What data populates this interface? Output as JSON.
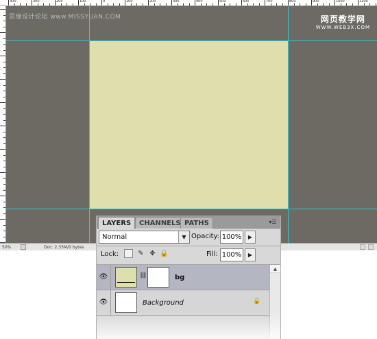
{
  "watermark": {
    "left": "思缘设计论坛 www.MISSYUAN.COM",
    "right_line1": "网页教学网",
    "right_line2": "WWW.WEB3X.COM"
  },
  "ruler": {
    "labels": [
      "400",
      "300",
      "200",
      "100",
      "0",
      "100",
      "200",
      "300",
      "400",
      "500",
      "600",
      "700",
      "800",
      "900",
      "1000",
      "1100",
      "1200",
      "1300"
    ]
  },
  "status_bar": {
    "zoom": "50%",
    "doc_info": "Doc: 2.33M/0 bytes"
  },
  "colors": {
    "canvas_background": "#6c6a63",
    "document_fill": "#dfdfae",
    "guide": "#31c6d4",
    "selected_layer": "#b4b6c2"
  },
  "layers_panel": {
    "tabs": [
      {
        "label": "LAYERS",
        "active": true
      },
      {
        "label": "CHANNELS",
        "active": false
      },
      {
        "label": "PATHS",
        "active": false
      }
    ],
    "menu_icon": "panel-menu-icon",
    "blend_mode": "Normal",
    "opacity_label": "Opacity:",
    "opacity_value": "100%",
    "lock_label": "Lock:",
    "fill_label": "Fill:",
    "fill_value": "100%",
    "layers": [
      {
        "name": "bg",
        "selected": true,
        "visible": true,
        "thumbnail_color": "#dfdfae",
        "has_mask": true,
        "locked": false
      },
      {
        "name": "Background",
        "selected": false,
        "visible": true,
        "thumbnail_color": "#ffffff",
        "has_mask": false,
        "locked": true
      }
    ]
  }
}
